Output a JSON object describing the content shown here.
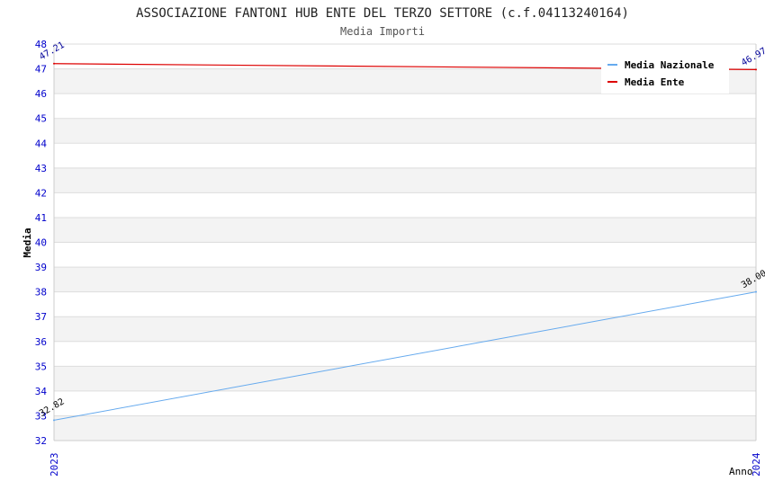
{
  "chart_data": {
    "type": "line",
    "title": "ASSOCIAZIONE FANTONI HUB ENTE DEL TERZO SETTORE (c.f.04113240164)",
    "subtitle": "Media Importi",
    "xlabel": "Anno",
    "ylabel": "Media",
    "x": [
      "2023",
      "2024"
    ],
    "ylim": [
      32,
      48
    ],
    "yticks": [
      32,
      33,
      34,
      35,
      36,
      37,
      38,
      39,
      40,
      41,
      42,
      43,
      44,
      45,
      46,
      47,
      48
    ],
    "grid": true,
    "legend_position": "top-right",
    "series": [
      {
        "name": "Media Nazionale",
        "values": [
          32.82,
          38.0
        ],
        "labels": [
          "32.82",
          "38.00"
        ],
        "color": "#66aaee",
        "label_color": "#000000"
      },
      {
        "name": "Media Ente",
        "values": [
          47.21,
          46.97
        ],
        "labels": [
          "47.21",
          "46.97"
        ],
        "color": "#dd0000",
        "label_color": "#000099"
      }
    ]
  }
}
